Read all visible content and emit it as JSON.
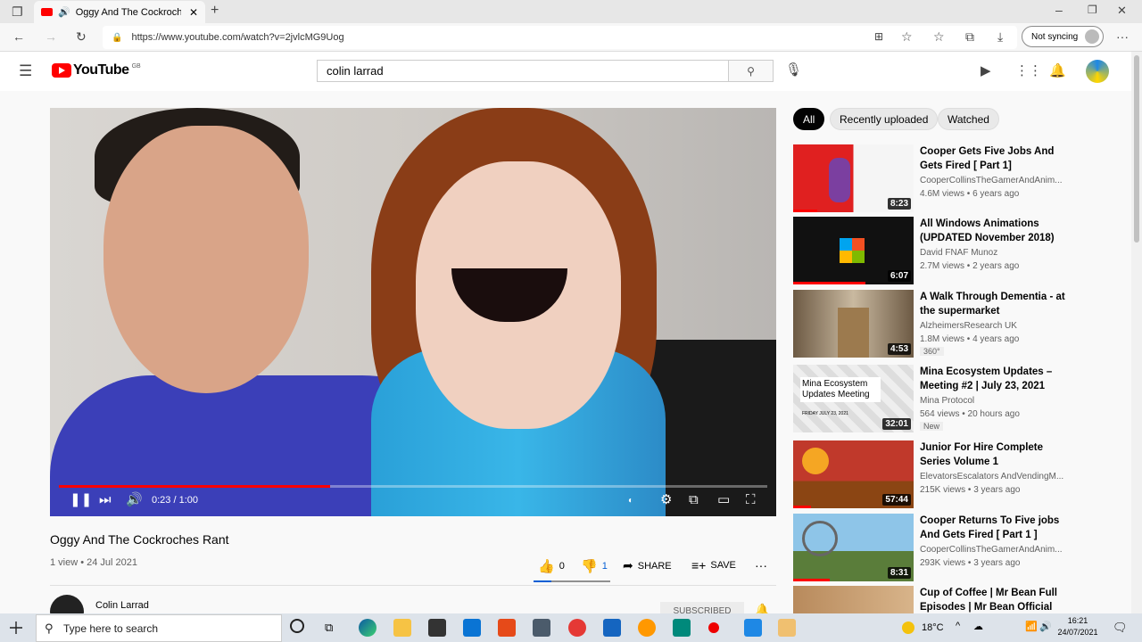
{
  "browser": {
    "tab_title": "Oggy And The Cockroches",
    "url": "https://www.youtube.com/watch?v=2jvlcMG9Uog",
    "sync_label": "Not syncing"
  },
  "youtube": {
    "logo_text": "YouTube",
    "region": "GB",
    "search_value": "colin larrad"
  },
  "player": {
    "time": "0:23 / 1:00",
    "progress": 0.383
  },
  "video": {
    "title": "Oggy And The Cockroches Rant",
    "meta": "1 view • 24 Jul 2021",
    "likes": "0",
    "dislikes": "1",
    "share_label": "SHARE",
    "save_label": "SAVE",
    "channel": "Colin Larrad",
    "subscribe_label": "SUBSCRIBED"
  },
  "chips": [
    "All",
    "Recently uploaded",
    "Watched"
  ],
  "recommendations": [
    {
      "title": "Cooper Gets Five Jobs And Gets Fired [ Part 1]",
      "channel": "CooperCollinsTheGamerAndAnim...",
      "views": "4.6M views • 6 years ago",
      "duration": "8:23",
      "badge": ""
    },
    {
      "title": "All Windows Animations (UPDATED November 2018)",
      "channel": "David FNAF Munoz",
      "views": "2.7M views • 2 years ago",
      "duration": "6:07",
      "badge": ""
    },
    {
      "title": "A Walk Through Dementia - at the supermarket",
      "channel": "AlzheimersResearch UK",
      "views": "1.8M views • 4 years ago",
      "duration": "4:53",
      "badge": "360°"
    },
    {
      "title": "Mina Ecosystem Updates – Meeting #2 | July 23, 2021",
      "channel": "Mina Protocol",
      "views": "564 views • 20 hours ago",
      "duration": "32:01",
      "badge": "New"
    },
    {
      "title": "Junior For Hire Complete Series Volume 1",
      "channel": "ElevatorsEscalators AndVendingM...",
      "views": "215K views • 3 years ago",
      "duration": "57:44",
      "badge": ""
    },
    {
      "title": "Cooper Returns To Five jobs And Gets Fired [ Part 1 ]",
      "channel": "CooperCollinsTheGamerAndAnim...",
      "views": "293K views • 3 years ago",
      "duration": "8:31",
      "badge": ""
    },
    {
      "title": "Cup of Coffee | Mr Bean Full Episodes | Mr Bean Official",
      "channel": "",
      "views": "",
      "duration": "",
      "badge": ""
    }
  ],
  "thumb_texts": {
    "mina": "Mina Ecosystem Updates Meeting",
    "mina_date": "FRIDAY JULY 23, 2021"
  },
  "taskbar": {
    "search_placeholder": "Type here to search",
    "temperature": "18°C",
    "time": "16:21",
    "date": "24/07/2021"
  }
}
